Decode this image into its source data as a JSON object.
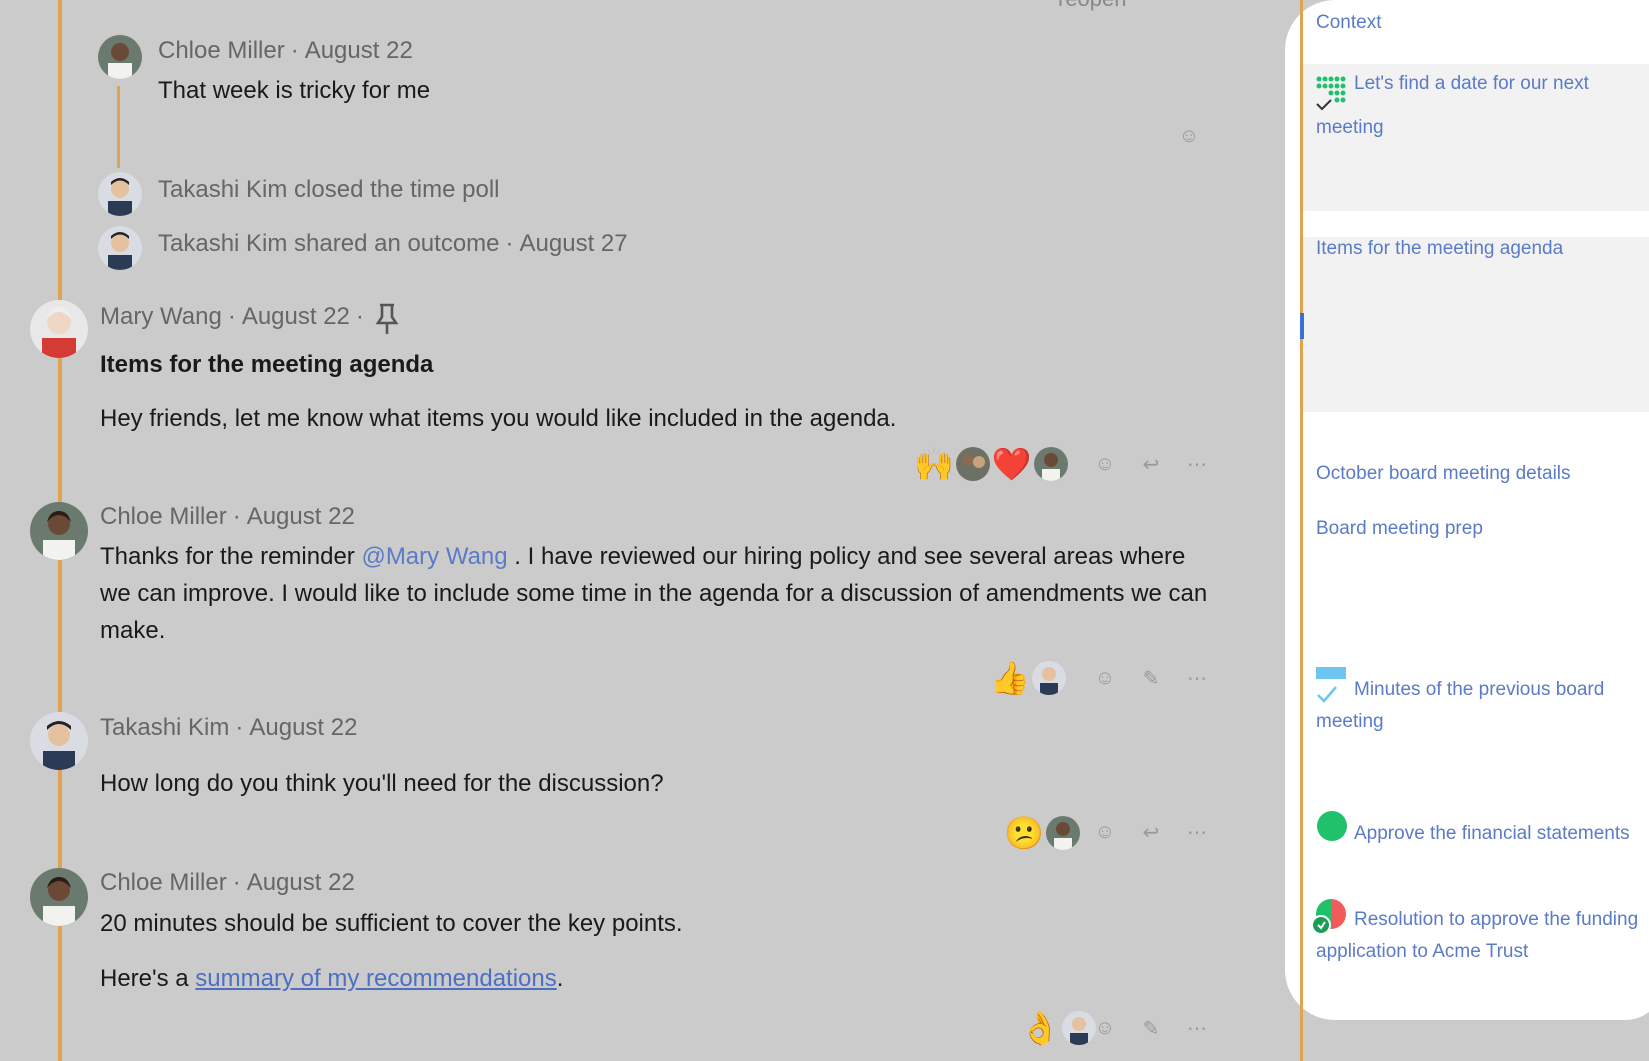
{
  "top_cut_text": "reopen",
  "messages": [
    {
      "author": "Chloe Miller",
      "date": "August 22",
      "text": "That week is tricky for me"
    },
    {
      "author": "Takashi Kim",
      "event": "closed the time poll"
    },
    {
      "author": "Takashi Kim",
      "event": "shared an outcome",
      "date": "August 27"
    },
    {
      "author": "Mary Wang",
      "date": "August 22",
      "title": "Items for the meeting agenda",
      "text": "Hey friends, let me know what items you would like included in the agenda.",
      "reactions": [
        "🙌",
        "❤️"
      ]
    },
    {
      "author": "Chloe Miller",
      "date": "August 22",
      "text_pre": "Thanks for the reminder ",
      "mention": "@Mary Wang",
      "text_post": " . I have reviewed our hiring policy and see several areas where we can improve. I would like to include some time in the agenda for a discussion of amendments we can make.",
      "reactions": [
        "👍"
      ]
    },
    {
      "author": "Takashi Kim",
      "date": "August 22",
      "text": "How long do you think you'll need for the discussion?",
      "reactions": [
        "😕"
      ]
    },
    {
      "author": "Chloe Miller",
      "date": "August 22",
      "text": "20 minutes should be sufficient to cover the key points.",
      "text2_pre": "Here's a ",
      "link": "summary of my recommendations",
      "text2_post": ".",
      "reactions": [
        "👌"
      ]
    }
  ],
  "separator": "·",
  "side_panel": {
    "context": "Context",
    "items": [
      {
        "label": "Let's find a date for our next meeting",
        "icon": "poll-icon"
      },
      {
        "label": "Items for the meeting agenda"
      },
      {
        "label": "October board meeting details"
      },
      {
        "label": "Board meeting prep"
      },
      {
        "label": "Minutes of the previous board meeting",
        "icon": "task-icon"
      },
      {
        "label": "Approve the financial statements",
        "icon": "vote-green-icon"
      },
      {
        "label": "Resolution to approve the funding application to Acme Trust",
        "icon": "vote-split-icon"
      }
    ]
  },
  "colors": {
    "thread": "#e0a450",
    "link": "#5b7bc7",
    "background": "#cbcbcb"
  }
}
